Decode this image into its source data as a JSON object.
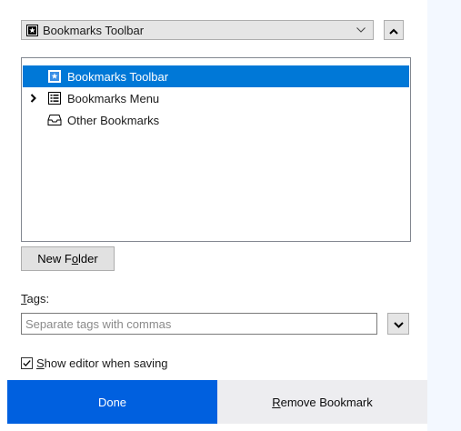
{
  "folder_select": {
    "selected_label": "Bookmarks Toolbar",
    "icon": "bookmarks-toolbar-icon",
    "chevron_icon": "chevron-down-icon",
    "collapse_icon": "chevron-up-icon"
  },
  "tree": {
    "items": [
      {
        "label": "Bookmarks Toolbar",
        "icon": "bookmarks-toolbar-icon",
        "selected": true,
        "expandable": false
      },
      {
        "label": "Bookmarks Menu",
        "icon": "bookmarks-menu-icon",
        "selected": false,
        "expandable": true
      },
      {
        "label": "Other Bookmarks",
        "icon": "other-bookmarks-icon",
        "selected": false,
        "expandable": false
      }
    ]
  },
  "new_folder": {
    "label_pre": "New F",
    "label_access": "o",
    "label_post": "lder"
  },
  "tags": {
    "label_access": "T",
    "label_post": "ags:",
    "value": "",
    "placeholder": "Separate tags with commas"
  },
  "editor_option": {
    "checked": true,
    "label_access": "S",
    "label_post": "how editor when saving"
  },
  "footer": {
    "done_label": "Done",
    "remove_access": "R",
    "remove_post": "emove Bookmark"
  },
  "colors": {
    "accent": "#0060df",
    "selection": "#0078d7",
    "side_bg": "#f3f8ff"
  }
}
